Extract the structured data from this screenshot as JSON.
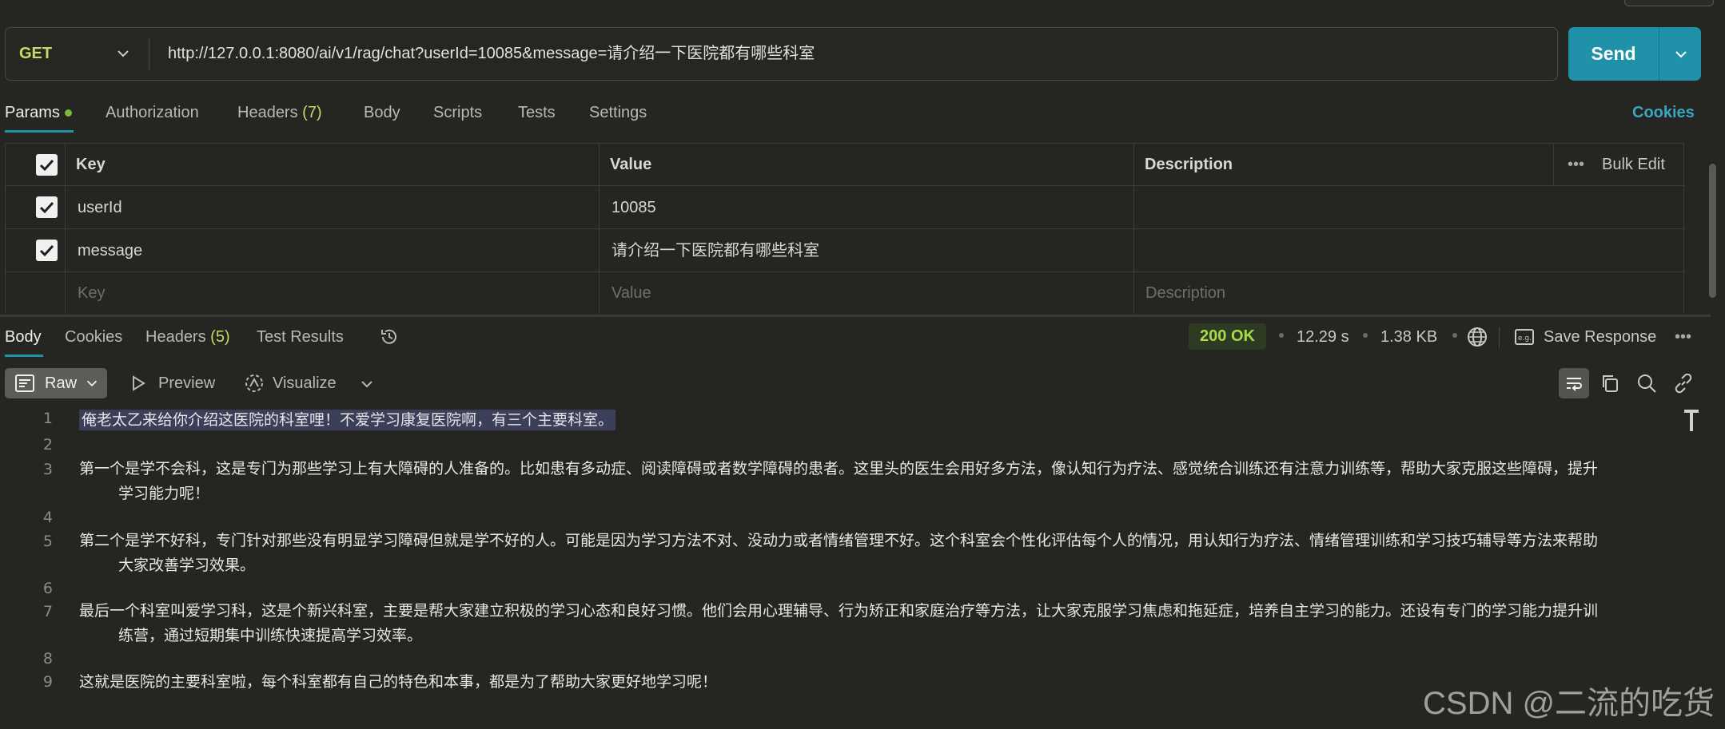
{
  "request": {
    "method": "GET",
    "url": "http://127.0.0.1:8080/ai/v1/rag/chat?userId=10085&message=请介绍一下医院都有哪些科室",
    "send_label": "Send"
  },
  "request_tabs": {
    "params": "Params",
    "authorization": "Authorization",
    "headers": "Headers",
    "headers_count": "(7)",
    "body": "Body",
    "scripts": "Scripts",
    "tests": "Tests",
    "settings": "Settings",
    "cookies": "Cookies"
  },
  "params_table": {
    "headers": {
      "key": "Key",
      "value": "Value",
      "description": "Description",
      "bulk_edit": "Bulk Edit"
    },
    "rows": [
      {
        "checked": true,
        "key": "userId",
        "value": "10085",
        "description": ""
      },
      {
        "checked": true,
        "key": "message",
        "value": "请介绍一下医院都有哪些科室",
        "description": ""
      }
    ],
    "placeholders": {
      "key": "Key",
      "value": "Value",
      "description": "Description"
    }
  },
  "response_tabs": {
    "body": "Body",
    "cookies": "Cookies",
    "headers": "Headers",
    "headers_count": "(5)",
    "test_results": "Test Results"
  },
  "response_meta": {
    "status": "200 OK",
    "time": "12.29 s",
    "size": "1.38 KB",
    "save_response": "Save Response",
    "status_color": "#a6dc4a"
  },
  "response_toolbar": {
    "raw": "Raw",
    "preview": "Preview",
    "visualize": "Visualize"
  },
  "response_body": {
    "line_numbers": [
      "1",
      "2",
      "3",
      "4",
      "5",
      "6",
      "7",
      "8",
      "9"
    ],
    "line1": "俺老太乙来给你介绍这医院的科室哩！不爱学习康复医院啊，有三个主要科室。",
    "line3a": "第一个是学不会科，这是专门为那些学习上有大障碍的人准备的。比如患有多动症、阅读障碍或者数学障碍的患者。这里头的医生会用好多方法，像认知行为疗法、感觉统合训练还有注意力训练等，帮助大家克服这些障碍，提升",
    "line3b": "学习能力呢！",
    "line5a": "第二个是学不好科，专门针对那些没有明显学习障碍但就是学不好的人。可能是因为学习方法不对、没动力或者情绪管理不好。这个科室会个性化评估每个人的情况，用认知行为疗法、情绪管理训练和学习技巧辅导等方法来帮助",
    "line5b": "大家改善学习效果。",
    "line7a": "最后一个科室叫爱学习科，这是个新兴科室，主要是帮大家建立积极的学习心态和良好习惯。他们会用心理辅导、行为矫正和家庭治疗等方法，让大家克服学习焦虑和拖延症，培养自主学习的能力。还设有专门的学习能力提升训",
    "line7b": "练营，通过短期集中训练快速提高学习效率。",
    "line9": "这就是医院的主要科室啦，每个科室都有自己的特色和本事，都是为了帮助大家更好地学习呢！"
  },
  "watermark": "CSDN @二流的吃货",
  "colors": {
    "accent": "#1f91a9",
    "method": "#c8d96a",
    "background": "#252521"
  }
}
